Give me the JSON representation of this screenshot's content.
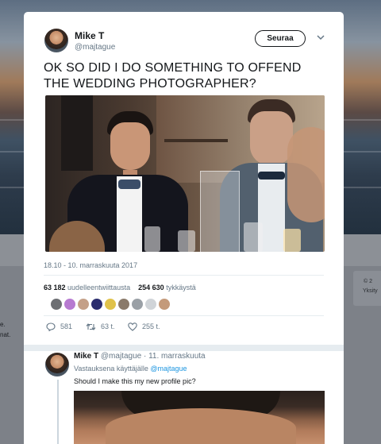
{
  "background": {
    "left_text": "e.\nnat.",
    "right_card_text_1": "© 2",
    "right_card_text_2": "Yksity"
  },
  "tweet": {
    "author_name": "Mike T",
    "author_handle": "@majtague",
    "follow_label": "Seuraa",
    "text": "OK SO DID I DO SOMETHING TO OFFEND THE WEDDING PHOTOGRAPHER?",
    "timestamp": "18.10 - 10. marraskuuta 2017",
    "retweets_count": "63 182",
    "retweets_label": "uudelleentwiittausta",
    "likes_count": "254 630",
    "likes_label": "tykkäystä",
    "actions": {
      "replies": "581",
      "retweets": "63 t.",
      "likes": "255 t."
    },
    "liker_colors": [
      "#6d6f73",
      "#b77ad1",
      "#c4a088",
      "#2b2d6e",
      "#e0c24a",
      "#8a7a6a",
      "#9aa0a6",
      "#d0d4d8",
      "#c49a7a"
    ]
  },
  "reply": {
    "author_name": "Mike T",
    "meta": "@majtague · 11. marraskuuta",
    "replying_prefix": "Vastauksena käyttäjälle",
    "replying_to": "@majtague",
    "text": "Should I make this my new profile pic?"
  },
  "colors": {
    "text_primary": "#14171a",
    "text_secondary": "#657786",
    "link": "#1b95e0"
  }
}
